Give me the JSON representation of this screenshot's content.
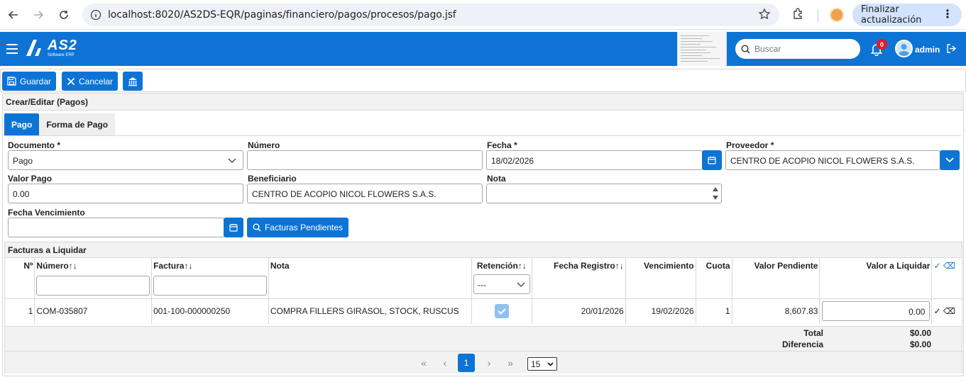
{
  "browser": {
    "url": "localhost:8020/AS2DS-EQR/paginas/financiero/pagos/procesos/pago.jsf",
    "update_label": "Finalizar actualización"
  },
  "header": {
    "logo_text": "AS2",
    "logo_sub": "Software ERP",
    "search_placeholder": "Buscar",
    "notifications": "0",
    "user": "admin"
  },
  "toolbar": {
    "save_label": "Guardar",
    "cancel_label": "Cancelar"
  },
  "panel": {
    "title": "Crear/Editar (Pagos)",
    "tabs": [
      {
        "label": "Pago"
      },
      {
        "label": "Forma de Pago"
      }
    ]
  },
  "form": {
    "documento_label": "Documento *",
    "documento_value": "Pago",
    "numero_label": "Número",
    "numero_value": "",
    "fecha_label": "Fecha *",
    "fecha_value": "18/02/2026",
    "proveedor_label": "Proveedor *",
    "proveedor_value": "CENTRO DE ACOPIO NICOL FLOWERS S.A.S.",
    "valor_label": "Valor Pago",
    "valor_value": "0.00",
    "beneficiario_label": "Beneficiario",
    "beneficiario_value": "CENTRO DE ACOPIO NICOL FLOWERS S.A.S.",
    "nota_label": "Nota",
    "nota_value": "",
    "vencimiento_label": "Fecha Vencimiento",
    "vencimiento_value": "",
    "facturas_button": "Facturas Pendientes"
  },
  "facturas": {
    "title": "Facturas a Liquidar",
    "columns": {
      "n": "Nº",
      "numero": "Número",
      "factura": "Factura",
      "nota": "Nota",
      "retencion": "Retención",
      "fecha_registro": "Fecha Registro",
      "vencimiento": "Vencimiento",
      "cuota": "Cuota",
      "valor_pendiente": "Valor Pendiente",
      "valor_liquidar": "Valor a Liquidar"
    },
    "retencion_filter": "---",
    "rows": [
      {
        "n": "1",
        "numero": "COM-035807",
        "factura": "001-100-000000250",
        "nota": "COMPRA FILLERS GIRASOL, STOCK, RUSCUS",
        "retencion": true,
        "fecha_registro": "20/01/2026",
        "vencimiento": "19/02/2026",
        "cuota": "1",
        "valor_pendiente": "8,607.83",
        "valor_liquidar": "0.00"
      }
    ],
    "total_label": "Total",
    "total_value": "$0.00",
    "diferencia_label": "Diferencia",
    "diferencia_value": "$0.00",
    "pager": {
      "first": "«",
      "prev": "‹",
      "page": "1",
      "next": "›",
      "last": "»",
      "rows_per_page": "15"
    }
  }
}
